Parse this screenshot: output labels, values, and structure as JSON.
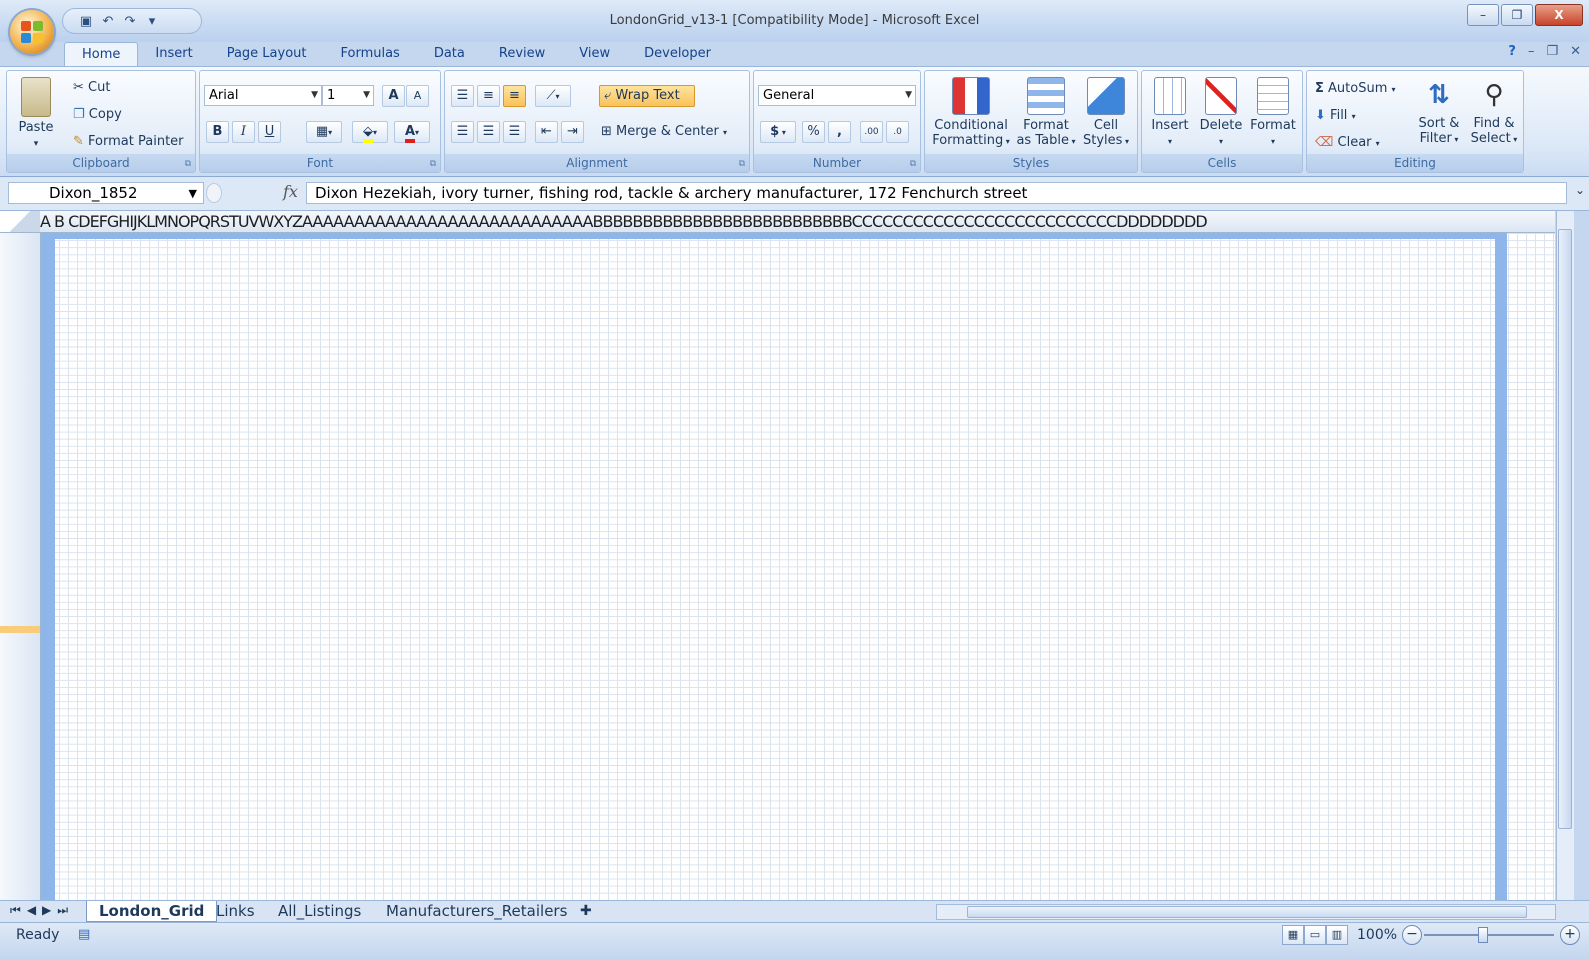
{
  "window": {
    "title": "LondonGrid_v13-1  [Compatibility Mode] - Microsoft Excel",
    "qat_icons": [
      "save-icon",
      "undo-icon",
      "redo-icon",
      "customize-icon"
    ],
    "controls": {
      "minimize": "–",
      "restore": "❐",
      "close": "X"
    }
  },
  "ribbon": {
    "tabs": [
      "Home",
      "Insert",
      "Page Layout",
      "Formulas",
      "Data",
      "Review",
      "View",
      "Developer"
    ],
    "active_tab": "Home",
    "help": "?",
    "clipboard": {
      "label": "Clipboard",
      "paste": "Paste",
      "cut": "Cut",
      "copy": "Copy",
      "format_painter": "Format Painter"
    },
    "font": {
      "label": "Font",
      "name": "Arial",
      "size": "1",
      "bold": "B",
      "italic": "I",
      "underline": "U",
      "grow": "A",
      "shrink": "A",
      "font_color": "A"
    },
    "alignment": {
      "label": "Alignment",
      "wrap_text": "Wrap Text",
      "merge_center": "Merge & Center"
    },
    "number": {
      "label": "Number",
      "format": "General",
      "currency": "$",
      "percent": "%",
      "comma": ",",
      "inc_dec": ".00",
      "dec_dec": ".0"
    },
    "styles": {
      "label": "Styles",
      "conditional": "Conditional",
      "conditional2": "Formatting",
      "format_table": "Format",
      "format_table2": "as Table",
      "cell_styles": "Cell",
      "cell_styles2": "Styles"
    },
    "cells": {
      "label": "Cells",
      "insert": "Insert",
      "delete": "Delete",
      "format": "Format"
    },
    "editing": {
      "label": "Editing",
      "autosum": "AutoSum",
      "fill": "Fill",
      "clear": "Clear",
      "sort": "Sort &",
      "sort2": "Filter",
      "find": "Find &",
      "find2": "Select"
    }
  },
  "formula_bar": {
    "name_box": "Dixon_1852",
    "fx": "fx",
    "formula": "Dixon Hezekiah, ivory turner, fishing rod, tackle & archery manufacturer, 172 Fenchurch street"
  },
  "grid": {
    "columns_text": "A B CDEFGHIJKLMNOPQRSTUVWXYZAAAAAAAAAAAAAAAAAAAAAAAAAAAABBBBBBBBBBBBBBBBBBBBBBBBBBCCCCCCCCCCCCCCCCCCCCCCCCCCDDDDDDDD",
    "selected_column": "B",
    "accent": "#8fb6ea"
  },
  "sheet_tabs": {
    "tabs": [
      "London_Grid",
      "Links",
      "All_Listings",
      "Manufacturers_Retailers"
    ],
    "active": "London_Grid"
  },
  "status": {
    "ready": "Ready",
    "zoom": "100%",
    "zoom_out": "−",
    "zoom_in": "+"
  }
}
